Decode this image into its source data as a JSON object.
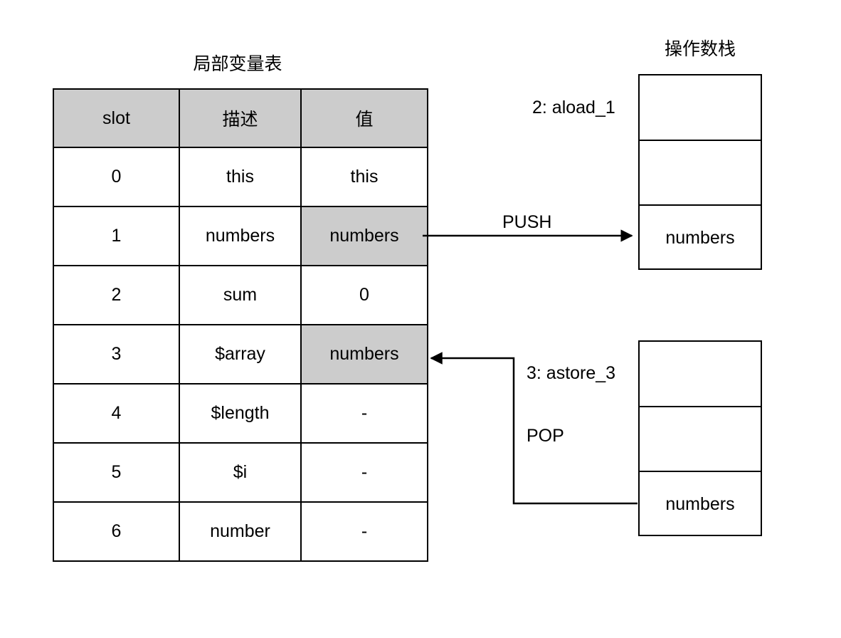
{
  "diagram": {
    "local_variable_table": {
      "title": "局部变量表",
      "columns": [
        "slot",
        "描述",
        "值"
      ],
      "rows": [
        {
          "slot": "0",
          "desc": "this",
          "value": "this",
          "value_highlighted": false
        },
        {
          "slot": "1",
          "desc": "numbers",
          "value": "numbers",
          "value_highlighted": true
        },
        {
          "slot": "2",
          "desc": "sum",
          "value": "0",
          "value_highlighted": false
        },
        {
          "slot": "3",
          "desc": "$array",
          "value": "numbers",
          "value_highlighted": true
        },
        {
          "slot": "4",
          "desc": "$length",
          "value": "-",
          "value_highlighted": false
        },
        {
          "slot": "5",
          "desc": "$i",
          "value": "-",
          "value_highlighted": false
        },
        {
          "slot": "6",
          "desc": "number",
          "value": "-",
          "value_highlighted": false
        }
      ]
    },
    "operand_stack": {
      "title": "操作数栈",
      "stacks": [
        {
          "id": "top",
          "cells": [
            "",
            "",
            "numbers"
          ]
        },
        {
          "id": "bottom",
          "cells": [
            "",
            "",
            "numbers"
          ]
        }
      ]
    },
    "edges": [
      {
        "id": "push",
        "instruction": "2: aload_1",
        "operation": "PUSH",
        "direction": "table-to-stack"
      },
      {
        "id": "pop",
        "instruction": "3: astore_3",
        "operation": "POP",
        "direction": "stack-to-table"
      }
    ],
    "colors": {
      "highlight": "#cccccc",
      "stroke": "#000000",
      "background": "#ffffff"
    }
  }
}
